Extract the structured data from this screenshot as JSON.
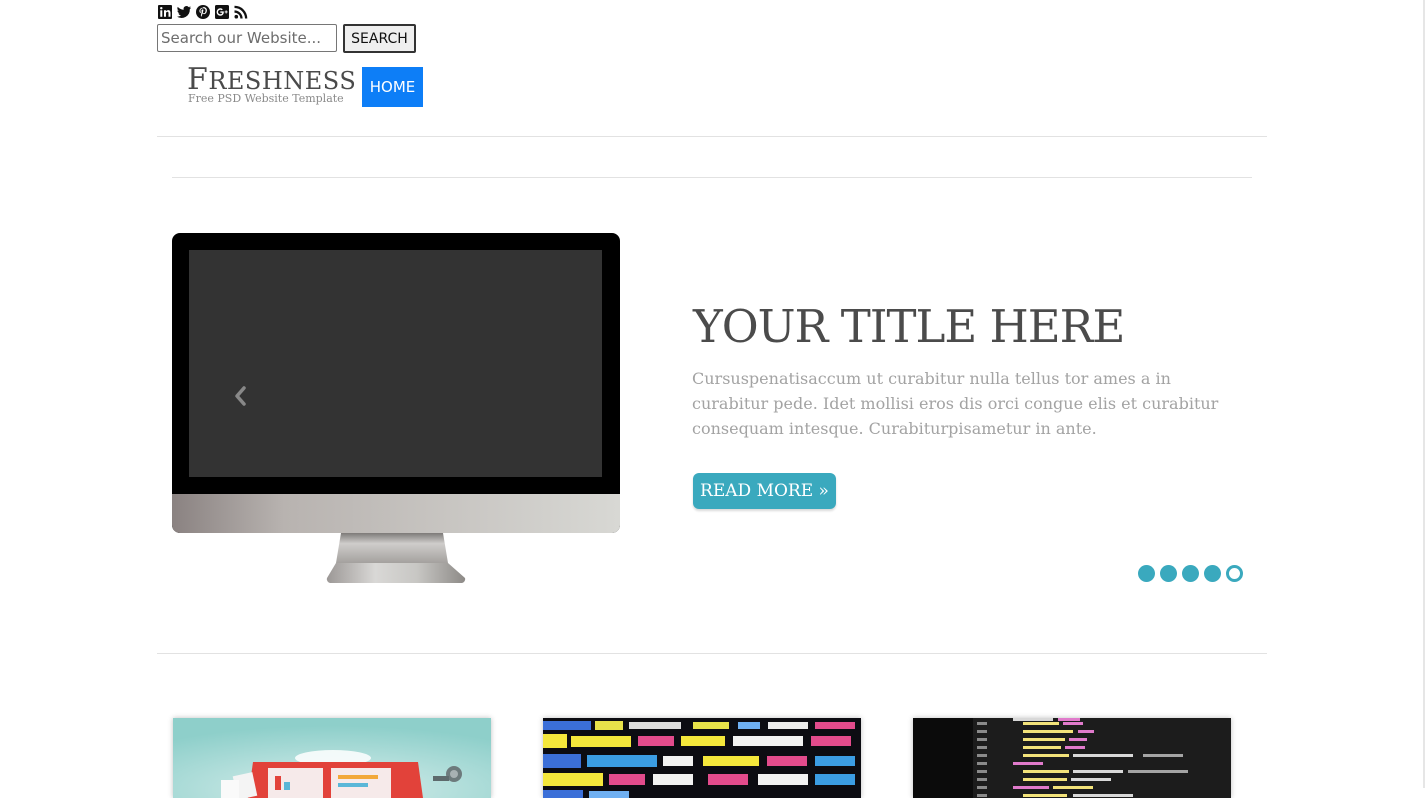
{
  "header": {
    "social_icons": [
      "linkedin-icon",
      "twitter-icon",
      "pinterest-icon",
      "google-plus-icon",
      "rss-icon"
    ],
    "search": {
      "placeholder": "Search our Website...",
      "button_label": "SEARCH"
    },
    "logo": {
      "title_cap": "F",
      "title_rest": "RESHNESS",
      "subtitle": "Free PSD Website Template"
    },
    "nav": {
      "home_label": "HOME"
    }
  },
  "slider": {
    "title": "YOUR TITLE HERE",
    "text": "Cursuspenatisaccum ut curabitur nulla tellus tor ames a in curabitur pede. Idet mollisi eros dis orci congue elis et curabitur consequam intesque. Curabiturpisametur in ante.",
    "button_label": "READ MORE »",
    "dots": [
      false,
      false,
      false,
      false,
      true
    ]
  },
  "colors": {
    "accent": "#3aa9be",
    "nav_active": "#0d7ef7",
    "title": "#4b4b4b",
    "body_text": "#a3a3a3"
  }
}
